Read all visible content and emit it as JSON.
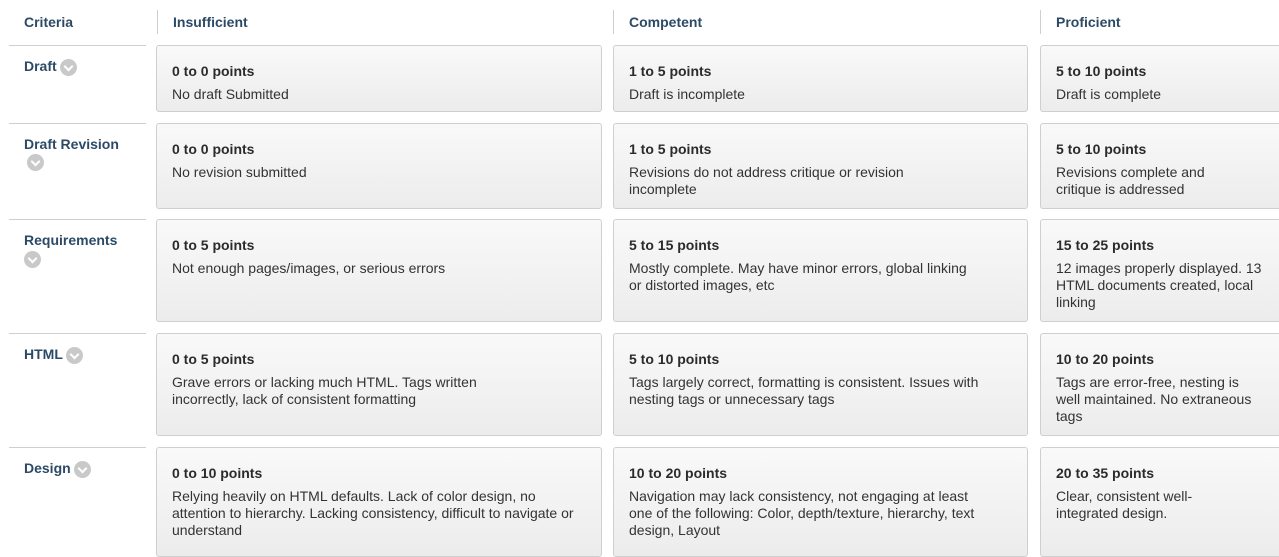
{
  "headers": {
    "criteria": "Criteria",
    "insufficient": "Insufficient",
    "competent": "Competent",
    "proficient": "Proficient"
  },
  "rows": [
    {
      "criterion": "Draft",
      "cells": [
        {
          "points": "0 to 0 points",
          "desc": "No draft Submitted"
        },
        {
          "points": "1 to 5 points",
          "desc": "Draft is incomplete"
        },
        {
          "points": "5 to 10 points",
          "desc": "Draft is complete"
        }
      ]
    },
    {
      "criterion": "Draft Revision",
      "cells": [
        {
          "points": "0 to 0 points",
          "desc": "No revision submitted"
        },
        {
          "points": "1 to 5 points",
          "desc": "Revisions do not address critique or revision incomplete"
        },
        {
          "points": "5 to 10 points",
          "desc": "Revisions complete and critique is addressed"
        }
      ]
    },
    {
      "criterion": "Requirements",
      "cells": [
        {
          "points": "0 to 5 points",
          "desc": "Not enough pages/images, or serious errors"
        },
        {
          "points": "5 to 15 points",
          "desc": "Mostly complete. May have minor errors, global linking or distorted images, etc"
        },
        {
          "points": "15 to 25 points",
          "desc": "12 images properly displayed. 13 HTML documents created, local linking"
        }
      ]
    },
    {
      "criterion": "HTML",
      "cells": [
        {
          "points": "0 to 5 points",
          "desc": "Grave errors or lacking much HTML. Tags written incorrectly, lack of consistent formatting"
        },
        {
          "points": "5 to 10 points",
          "desc": "Tags largely correct, formatting is consistent. Issues with nesting tags or unnecessary tags"
        },
        {
          "points": "10 to 20 points",
          "desc": "Tags are error-free, nesting is well maintained. No extraneous tags"
        }
      ]
    },
    {
      "criterion": "Design",
      "cells": [
        {
          "points": "0 to 10 points",
          "desc": "Relying heavily on HTML defaults. Lack of color design, no attention to hierarchy. Lacking consistency, difficult to navigate or understand"
        },
        {
          "points": "10 to 20 points",
          "desc": "Navigation may lack consistency, not engaging at least one of the following: Color, depth/texture, hierarchy, text design, Layout"
        },
        {
          "points": "20 to 35 points",
          "desc": "Clear, consistent well-integrated design."
        }
      ]
    }
  ],
  "icons": {
    "expand": "chevron-down-circle-icon"
  },
  "colors": {
    "header_text": "#2c4a66",
    "cell_bg": "#f0f0f0",
    "border": "#cfcfcf",
    "icon": "#c9c9c9"
  }
}
